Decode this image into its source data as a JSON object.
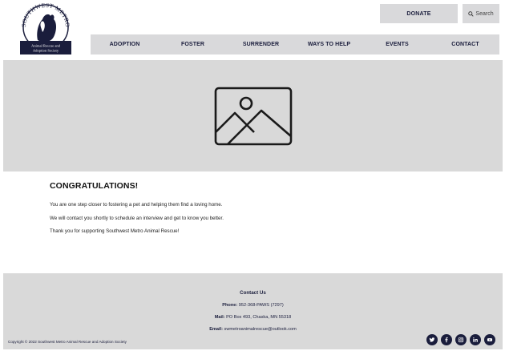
{
  "brand": {
    "logo_arc_text": "SOUTHWEST METRO",
    "logo_caption_1": "Animal Rescue and",
    "logo_caption_2": "Adoption Society",
    "navy": "#1a1d3c"
  },
  "header": {
    "donate_label": "DONATE",
    "search_label": "Search",
    "search_icon": "search-icon"
  },
  "nav": {
    "items": [
      {
        "label": "ADOPTION"
      },
      {
        "label": "FOSTER"
      },
      {
        "label": "SURRENDER"
      },
      {
        "label": "WAYS TO HELP"
      },
      {
        "label": "EVENTS"
      },
      {
        "label": "CONTACT"
      }
    ]
  },
  "hero": {
    "icon": "image-placeholder-icon"
  },
  "main": {
    "title": "CONGRATULATIONS!",
    "paragraphs": [
      "You are one step closer to fostering a pet and helping them find a loving home.",
      "We will contact you shortly to schedule an interview and get to know you better.",
      "Thank you for supporting Southwest Metro Animal Rescue!"
    ]
  },
  "footer": {
    "contact_title": "Contact Us",
    "phone_label": "Phone:",
    "phone_value": "952-368-PAWS (7297)",
    "mail_label": "Mail:",
    "mail_value": "PO Box 493, Chaska, MN 55318",
    "email_label": "Email:",
    "email_value": "swmetroanimalrescue@outlook.com",
    "copyright": "Copyright © 2022 Southwest Metro Animal Rescue and Adoption Society",
    "socials": [
      "twitter-icon",
      "facebook-icon",
      "instagram-icon",
      "linkedin-icon",
      "youtube-icon"
    ]
  }
}
